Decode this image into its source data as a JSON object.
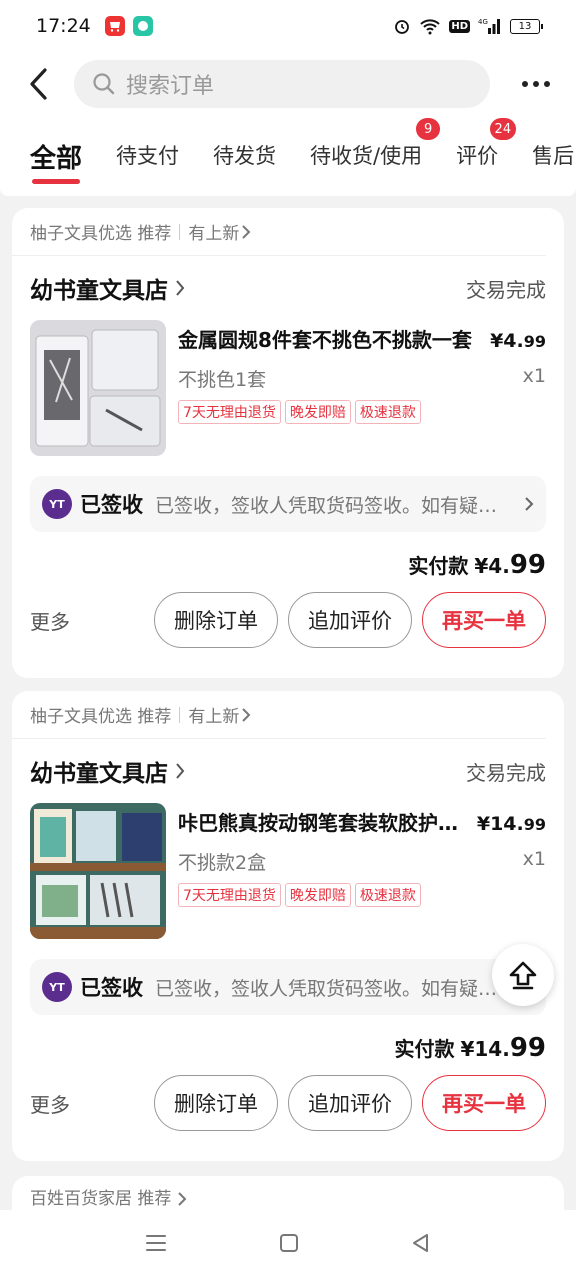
{
  "status_bar": {
    "time": "17:24",
    "network": "4G",
    "battery": "13",
    "hd": "HD"
  },
  "header": {
    "search_placeholder": "搜索订单"
  },
  "tabs": [
    {
      "label": "全部",
      "badge": ""
    },
    {
      "label": "待支付",
      "badge": ""
    },
    {
      "label": "待发货",
      "badge": ""
    },
    {
      "label": "待收货/使用",
      "badge": "9"
    },
    {
      "label": "评价",
      "badge": "24"
    },
    {
      "label": "售后",
      "badge": ""
    }
  ],
  "orders": [
    {
      "source": "柚子文具优选 推荐",
      "source_extra": "有上新",
      "shop": "幼书童文具店",
      "status": "交易完成",
      "product_title": "金属圆规8件套不挑色不挑款一套",
      "price_main": "¥4.",
      "price_cents": "99",
      "sku": "不挑色1套",
      "qty": "x1",
      "tags": [
        "7天无理由退货",
        "晚发即赔",
        "极速退款"
      ],
      "logistics_title": "已签收",
      "logistics_text": "已签收，签收人凭取货码签收。如有疑问请联系",
      "paid_label": "实付款",
      "paid_main": "¥4.",
      "paid_cents": "99",
      "more": "更多",
      "btn_delete": "删除订单",
      "btn_review": "追加评价",
      "btn_rebuy": "再买一单"
    },
    {
      "source": "柚子文具优选 推荐",
      "source_extra": "有上新",
      "shop": "幼书童文具店",
      "status": "交易完成",
      "product_title": "咔巴熊真按动钢笔套装软胶护手握笔",
      "price_main": "¥14.",
      "price_cents": "99",
      "sku": "不挑款2盒",
      "qty": "x1",
      "tags": [
        "7天无理由退货",
        "晚发即赔",
        "极速退款"
      ],
      "logistics_title": "已签收",
      "logistics_text": "已签收，签收人凭取货码签收。如有疑问请联系",
      "paid_label": "实付款",
      "paid_main": "¥14.",
      "paid_cents": "99",
      "more": "更多",
      "btn_delete": "删除订单",
      "btn_review": "追加评价",
      "btn_rebuy": "再买一单"
    }
  ],
  "next_card_source": "百姓百货家居 推荐",
  "logistics_logo": "YT",
  "colors": {
    "accent": "#e7323f",
    "background": "#f2f2f2"
  }
}
